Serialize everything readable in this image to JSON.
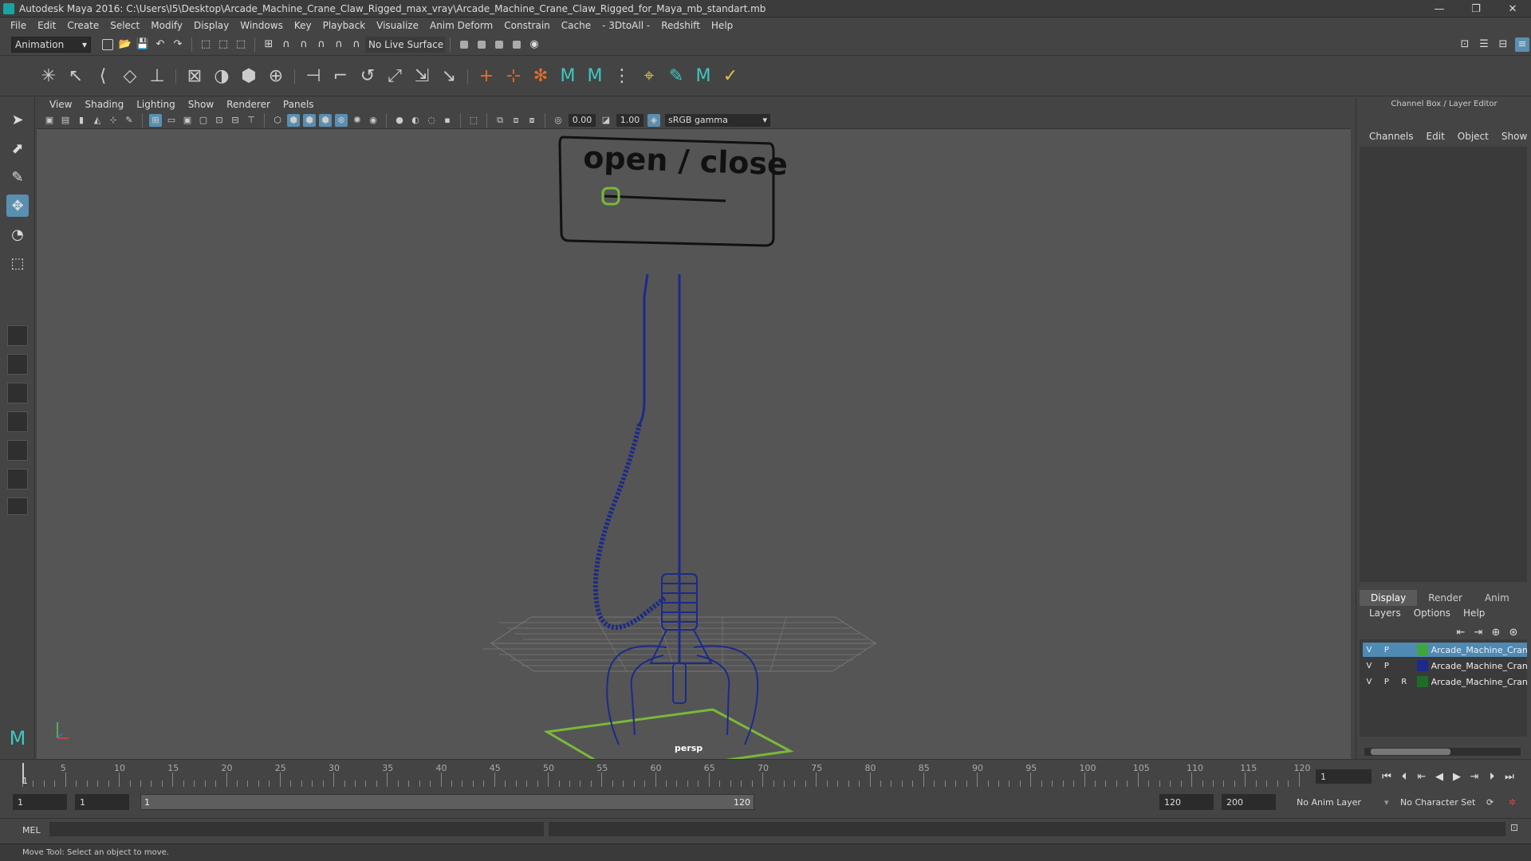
{
  "title": "Autodesk Maya 2016: C:\\Users\\I5\\Desktop\\Arcade_Machine_Crane_Claw_Rigged_max_vray\\Arcade_Machine_Crane_Claw_Rigged_for_Maya_mb_standart.mb",
  "menus": [
    "File",
    "Edit",
    "Create",
    "Select",
    "Modify",
    "Display",
    "Windows",
    "Key",
    "Playback",
    "Visualize",
    "Anim Deform",
    "Constrain",
    "Cache",
    "- 3DtoAll -",
    "Redshift",
    "Help"
  ],
  "status": {
    "mode": "Animation",
    "live_surface": "No Live Surface"
  },
  "viewport": {
    "menus": [
      "View",
      "Shading",
      "Lighting",
      "Show",
      "Renderer",
      "Panels"
    ],
    "exposure": "0.00",
    "gamma": "1.00",
    "color_space": "sRGB gamma",
    "camera_label": "persp",
    "sign_text": "open / close",
    "colors": {
      "wire": "#1c2a8a",
      "control": "#7ab83a",
      "background": "#555555"
    }
  },
  "channel_box": {
    "title": "Channel Box / Layer Editor",
    "menus": [
      "Channels",
      "Edit",
      "Object",
      "Show"
    ],
    "tabs": [
      "Display",
      "Render",
      "Anim"
    ],
    "active_tab": "Display",
    "layer_menus": [
      "Layers",
      "Options",
      "Help"
    ],
    "layers": [
      {
        "v": "V",
        "p": "P",
        "r": "",
        "color": "#3fa63f",
        "name": "Arcade_Machine_Cran",
        "selected": true
      },
      {
        "v": "V",
        "p": "P",
        "r": "",
        "color": "#1c2a8a",
        "name": "Arcade_Machine_Cran",
        "selected": false
      },
      {
        "v": "V",
        "p": "P",
        "r": "R",
        "color": "#1f6b2a",
        "name": "Arcade_Machine_Cran",
        "selected": false
      }
    ]
  },
  "timeline": {
    "ticks": [
      "5",
      "10",
      "15",
      "20",
      "25",
      "30",
      "35",
      "40",
      "45",
      "50",
      "55",
      "60",
      "65",
      "70",
      "75",
      "80",
      "85",
      "90",
      "95",
      "100",
      "105",
      "110",
      "115",
      "120"
    ],
    "start_marker": "1",
    "current_frame": "1"
  },
  "range": {
    "start": "1",
    "playback_start": "1",
    "bar_start": "1",
    "bar_end": "120",
    "playback_end": "120",
    "end": "200",
    "anim_layer": "No Anim Layer",
    "character_set": "No Character Set"
  },
  "command": {
    "lang": "MEL"
  },
  "help_line": "Move Tool: Select an object to move."
}
